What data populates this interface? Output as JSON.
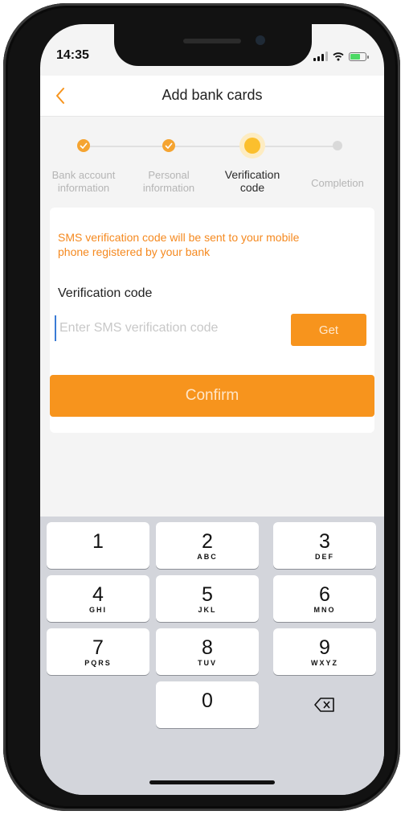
{
  "status_bar": {
    "time": "14:35"
  },
  "nav": {
    "title": "Add bank cards",
    "back_icon": "chevron-left-icon"
  },
  "steps": [
    {
      "label_line1": "Bank account",
      "label_line2": "information",
      "state": "done"
    },
    {
      "label_line1": "Personal",
      "label_line2": "information",
      "state": "done"
    },
    {
      "label_line1": "Verification",
      "label_line2": "code",
      "state": "active"
    },
    {
      "label_line1": "Completion",
      "label_line2": "",
      "state": "pending"
    }
  ],
  "form": {
    "notice_line1": "SMS verification code will be sent to your mobile",
    "notice_line2": "phone registered by your bank",
    "code_label": "Verification code",
    "code_placeholder": "Enter SMS verification code",
    "code_value": "",
    "get_label": "Get",
    "confirm_label": "Confirm"
  },
  "keypad": {
    "keys": [
      {
        "digit": "1",
        "letters": ""
      },
      {
        "digit": "2",
        "letters": "ABC"
      },
      {
        "digit": "3",
        "letters": "DEF"
      },
      {
        "digit": "4",
        "letters": "GHI"
      },
      {
        "digit": "5",
        "letters": "JKL"
      },
      {
        "digit": "6",
        "letters": "MNO"
      },
      {
        "digit": "7",
        "letters": "PQRS"
      },
      {
        "digit": "8",
        "letters": "TUV"
      },
      {
        "digit": "9",
        "letters": "WXYZ"
      },
      {
        "digit": "0",
        "letters": ""
      }
    ],
    "delete_icon": "backspace-icon"
  },
  "colors": {
    "accent": "#f7941d",
    "step_done": "#f5a431",
    "step_active": "#fbbf2d",
    "step_pending": "#d9d9d9",
    "notice_text": "#f5891f"
  }
}
